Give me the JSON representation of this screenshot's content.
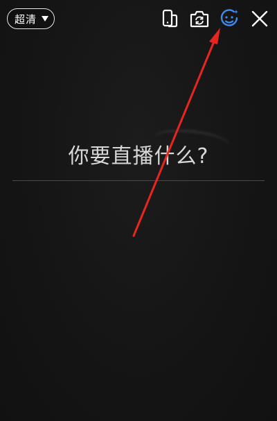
{
  "header": {
    "quality_label": "超清",
    "icons": [
      {
        "name": "rotate-phone-icon"
      },
      {
        "name": "switch-camera-icon"
      },
      {
        "name": "beauty-face-icon",
        "color": "#3d8bf5"
      },
      {
        "name": "close-icon"
      }
    ]
  },
  "main": {
    "title_prompt": "你要直播什么?"
  },
  "colors": {
    "background": "#141414",
    "accent": "#3d8bf5",
    "annotation_arrow": "#e8251f"
  }
}
